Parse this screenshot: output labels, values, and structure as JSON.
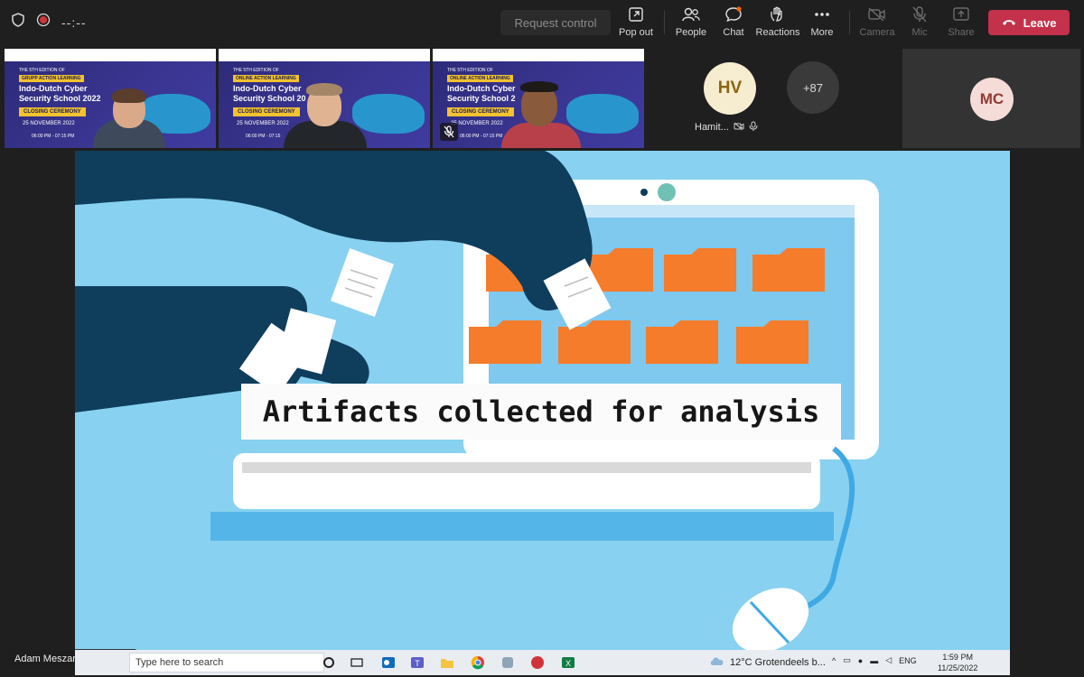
{
  "toolbar": {
    "timer": "--:--",
    "request_control": "Request control",
    "pop_out": "Pop out",
    "people": "People",
    "chat": "Chat",
    "reactions": "Reactions",
    "more": "More",
    "camera": "Camera",
    "mic": "Mic",
    "share": "Share",
    "leave": "Leave"
  },
  "participants": {
    "tiles": [
      {
        "sub": "THE 5TH EDITION OF",
        "tag": "GRUPP ACTION LEARNING",
        "title": "Indo-Dutch Cyber Security School 2022",
        "ceremony": "CLOSING CEREMONY",
        "date": "25 NOVEMBER 2022",
        "time": "06:00 PM - 07:15 PM"
      },
      {
        "sub": "THE 5TH EDITION OF",
        "tag": "ONLINE ACTION LEARNING",
        "title": "Indo-Dutch Cyber Security School 20",
        "ceremony": "CLOSING CEREMONY",
        "date": "25 NOVEMBER 2022",
        "time": "06:00 PM - 07:15"
      },
      {
        "sub": "THE 5TH EDITION OF",
        "tag": "ONLINE ACTION LEARNING",
        "title": "Indo-Dutch Cyber Security School 2",
        "ceremony": "CLOSING CEREMONY",
        "date": "25 NOVEMBER 2022",
        "time": "06:00 PM - 07:15 PM"
      }
    ],
    "hv_initials": "HV",
    "hv_name": "Hamit...",
    "overflow_count": "+87",
    "mc_initials": "MC"
  },
  "stage": {
    "caption": "Artifacts collected for analysis",
    "presenter_name": "Adam Meszaros (External)"
  },
  "taskbar": {
    "search_placeholder": "Type here to search",
    "weather": "12°C  Grotendeels b...",
    "lang": "ENG",
    "time": "1:59 PM",
    "date": "11/25/2022"
  },
  "colors": {
    "leave": "#c4314b",
    "stage_bg": "#88d1f0",
    "folder": "#f57c2a",
    "hand": "#0f3d5c"
  }
}
